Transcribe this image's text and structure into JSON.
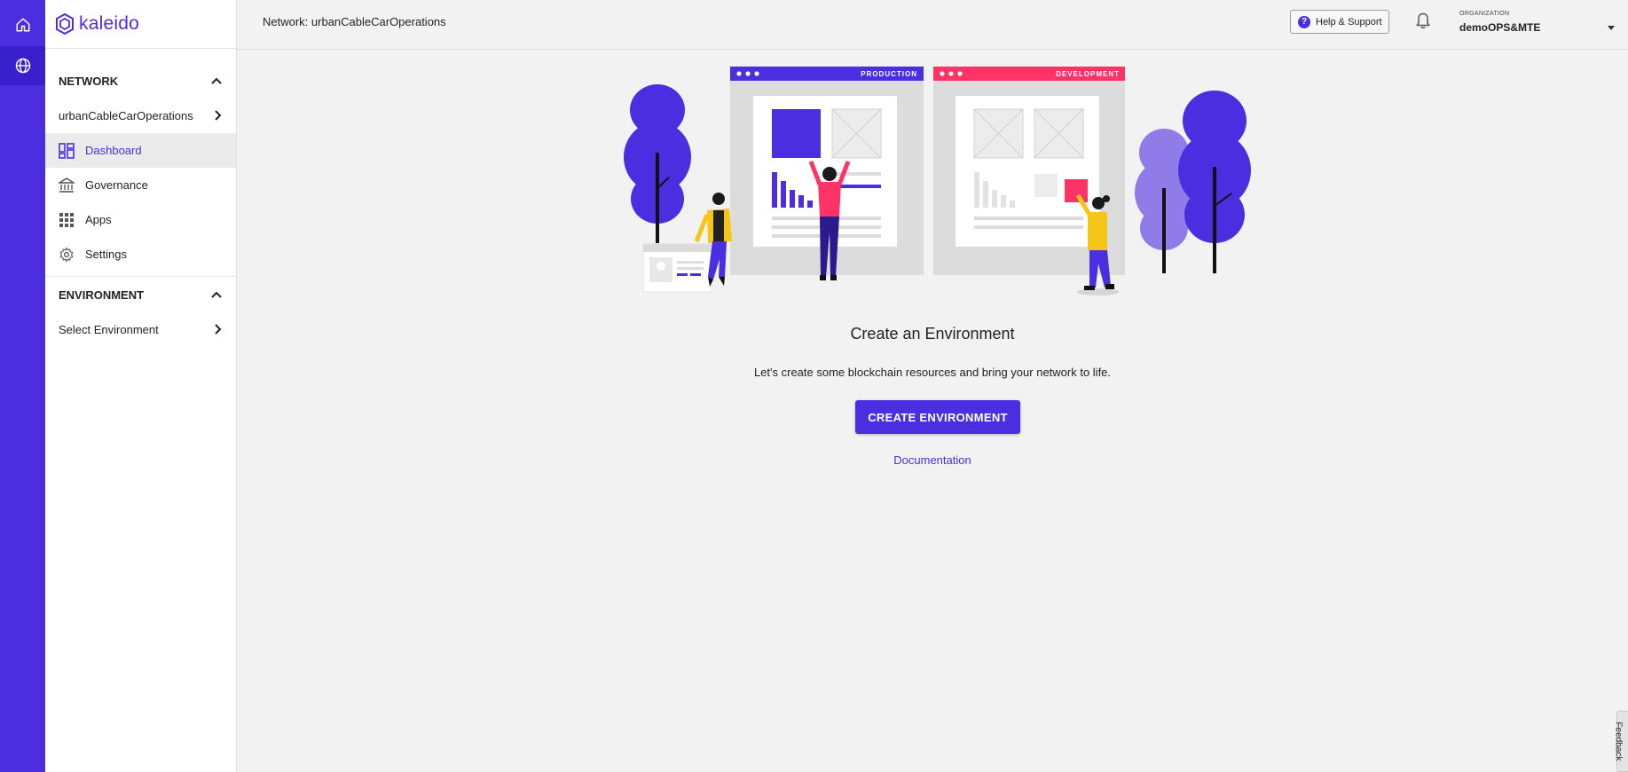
{
  "brand": {
    "name": "kaleido"
  },
  "rail": {
    "icons": [
      "home-icon",
      "globe-icon"
    ]
  },
  "sidebar": {
    "network_header": "NETWORK",
    "network_name": "urbanCableCarOperations",
    "items": [
      {
        "label": "Dashboard",
        "icon": "dashboard-icon",
        "active": true
      },
      {
        "label": "Governance",
        "icon": "bank-icon"
      },
      {
        "label": "Apps",
        "icon": "apps-grid-icon"
      },
      {
        "label": "Settings",
        "icon": "gear-icon"
      }
    ],
    "environment_header": "ENVIRONMENT",
    "environment_select": "Select Environment"
  },
  "topbar": {
    "breadcrumb": "Network: urbanCableCarOperations",
    "help_label": "Help & Support",
    "org_label": "ORGANIZATION",
    "org_name": "demoOPS&MTE"
  },
  "illustration": {
    "panel_left": "PRODUCTION",
    "panel_right": "DEVELOPMENT"
  },
  "main": {
    "title": "Create an Environment",
    "subtitle": "Let's create some blockchain resources and bring your network to life.",
    "cta_label": "CREATE ENVIRONMENT",
    "doc_link": "Documentation"
  },
  "feedback": {
    "label": "Feedback"
  },
  "colors": {
    "accent": "#4b2ee0",
    "dev_pink": "#ff3366",
    "yellow": "#f5c518"
  }
}
